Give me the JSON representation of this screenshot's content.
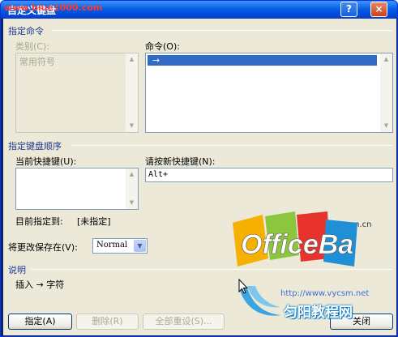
{
  "window": {
    "title": "自定义键盘",
    "watermark_url": "www.blue1000.com",
    "help_glyph": "?",
    "close_glyph": "×"
  },
  "command_section": {
    "heading": "指定命令",
    "category_label": "类别(C):",
    "category_items": [
      "常用符号"
    ],
    "command_label": "命令(O):",
    "command_items": [
      "→"
    ],
    "selected_command": "→"
  },
  "key_section": {
    "heading": "指定键盘顺序",
    "current_keys_label": "当前快捷键(U):",
    "current_keys": [],
    "new_key_label": "请按新快捷键(N):",
    "new_key_value": "Alt+",
    "assigned_label": "目前指定到:",
    "assigned_value": "[未指定]"
  },
  "save_in": {
    "label": "将更改保存在(V):",
    "value": "Normal"
  },
  "description": {
    "heading": "说明",
    "text": "插入 → 字符"
  },
  "buttons": {
    "assign": "指定(A)",
    "remove": "删除(R)",
    "reset_all": "全部重设(S)...",
    "close": "关闭"
  },
  "overlay": {
    "logo_small": "officeba.com.cn",
    "logo_text": "OfficeBa",
    "site_url": "http://www.vycsm.net",
    "brand_text": "匀阳教程网"
  }
}
